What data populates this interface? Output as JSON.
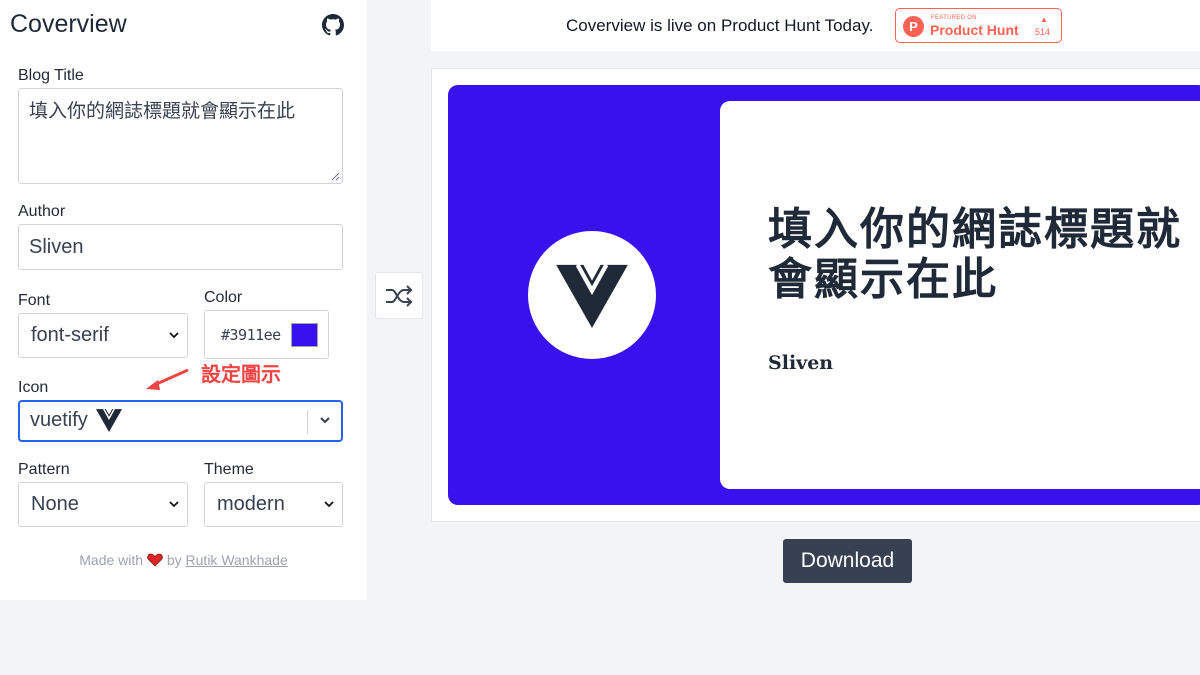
{
  "app": {
    "title": "Coverview",
    "github_icon": "github-icon"
  },
  "form": {
    "blog_title_label": "Blog Title",
    "blog_title_value": "填入你的網誌標題就會顯示在此",
    "author_label": "Author",
    "author_value": "Sliven",
    "font_label": "Font",
    "font_value": "font-serif",
    "color_label": "Color",
    "color_value": "#3911ee",
    "icon_label": "Icon",
    "icon_value": "vuetify",
    "icon_glyph": "vuetify-icon",
    "pattern_label": "Pattern",
    "pattern_value": "None",
    "theme_label": "Theme",
    "theme_value": "modern"
  },
  "annotation": {
    "text": "設定圖示",
    "color": "#ef4444"
  },
  "credit": {
    "made_with": "Made with",
    "heart_icon": "heart-icon",
    "by": "by",
    "author_link": "Rutik Wankhade"
  },
  "banner": {
    "text": "Coverview is live on Product Hunt Today.",
    "ph_featured": "FEATURED ON",
    "ph_name": "Product Hunt",
    "ph_logo": "P",
    "ph_upvote_icon": "upvote-triangle-icon",
    "ph_count": "514",
    "ph_color": "#ff6154"
  },
  "shuffle": {
    "icon": "shuffle-icon"
  },
  "preview": {
    "background_color": "#3911ee",
    "title": "填入你的網誌標題就會顯示在此",
    "author": "Sliven",
    "icon": "vuetify-icon"
  },
  "download": {
    "label": "Download"
  }
}
